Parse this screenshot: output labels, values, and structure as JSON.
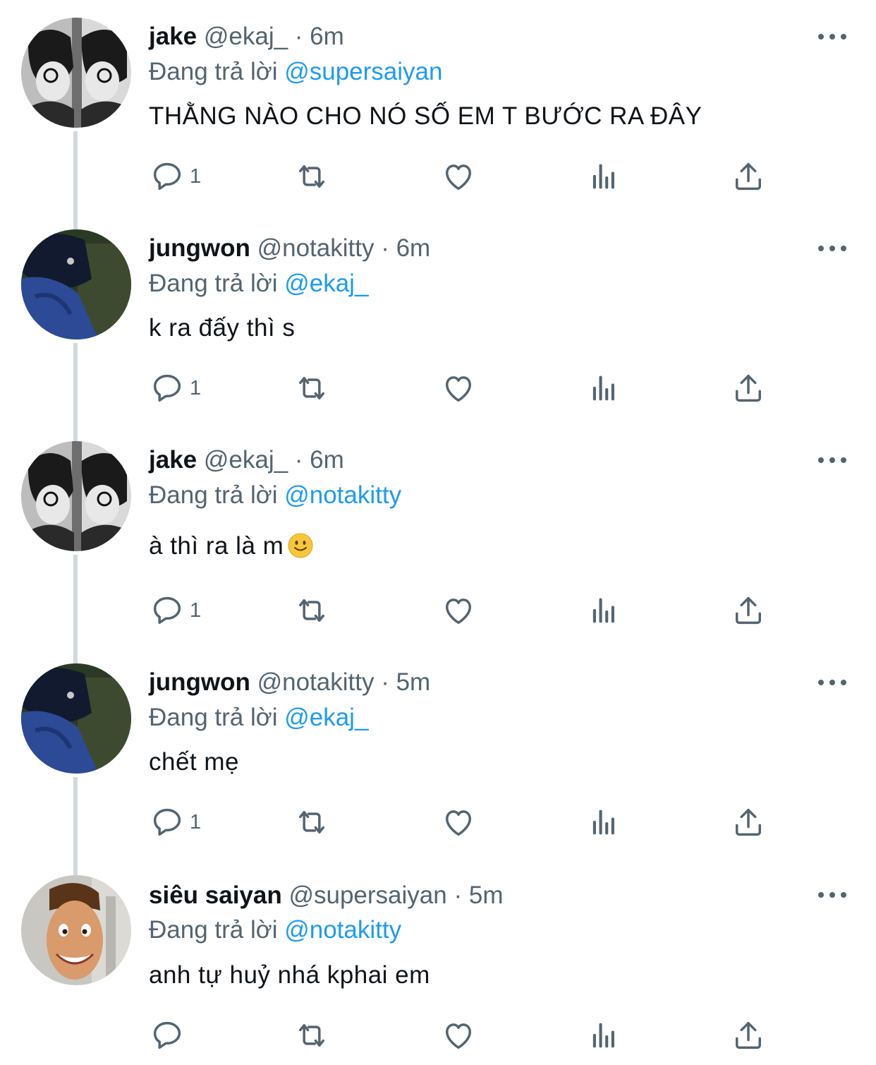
{
  "tweets": [
    {
      "name": "jake",
      "handle": "@ekaj_",
      "time": "· 6m",
      "replying_prefix": "Đang trả lời",
      "replying_to": "@supersaiyan",
      "text": "THẰNG NÀO CHO NÓ SỐ EM T BƯỚC RA ĐÂY",
      "reply_count": "1",
      "avatar": "bw-portrait-avatar"
    },
    {
      "name": "jungwon",
      "handle": "@notakitty",
      "time": "· 6m",
      "replying_prefix": "Đang trả lời",
      "replying_to": "@ekaj_",
      "text": "k ra đấy thì s",
      "reply_count": "1",
      "avatar": "blue-hoodie-avatar"
    },
    {
      "name": "jake",
      "handle": "@ekaj_",
      "time": "· 6m",
      "replying_prefix": "Đang trả lời",
      "replying_to": "@notakitty",
      "text": "à thì ra là m",
      "emoji": "slightly-smiling-face",
      "reply_count": "1",
      "avatar": "bw-portrait-avatar"
    },
    {
      "name": "jungwon",
      "handle": "@notakitty",
      "time": "· 5m",
      "replying_prefix": "Đang trả lời",
      "replying_to": "@ekaj_",
      "text": "chết mẹ",
      "reply_count": "1",
      "avatar": "blue-hoodie-avatar"
    },
    {
      "name": "siêu saiyan",
      "handle": "@supersaiyan",
      "time": "· 5m",
      "replying_prefix": "Đang trả lời",
      "replying_to": "@notakitty",
      "text": "anh tự huỷ nhá kphai em",
      "reply_count": "",
      "avatar": "cartoon-face-avatar"
    }
  ],
  "colors": {
    "mention": "#1d9bf0",
    "secondary_text": "#536471",
    "thread_line": "#cfd9de",
    "primary_text": "#0f1419"
  },
  "icons": [
    "reply-icon",
    "retweet-icon",
    "like-icon",
    "views-icon",
    "share-icon",
    "more-icon"
  ]
}
